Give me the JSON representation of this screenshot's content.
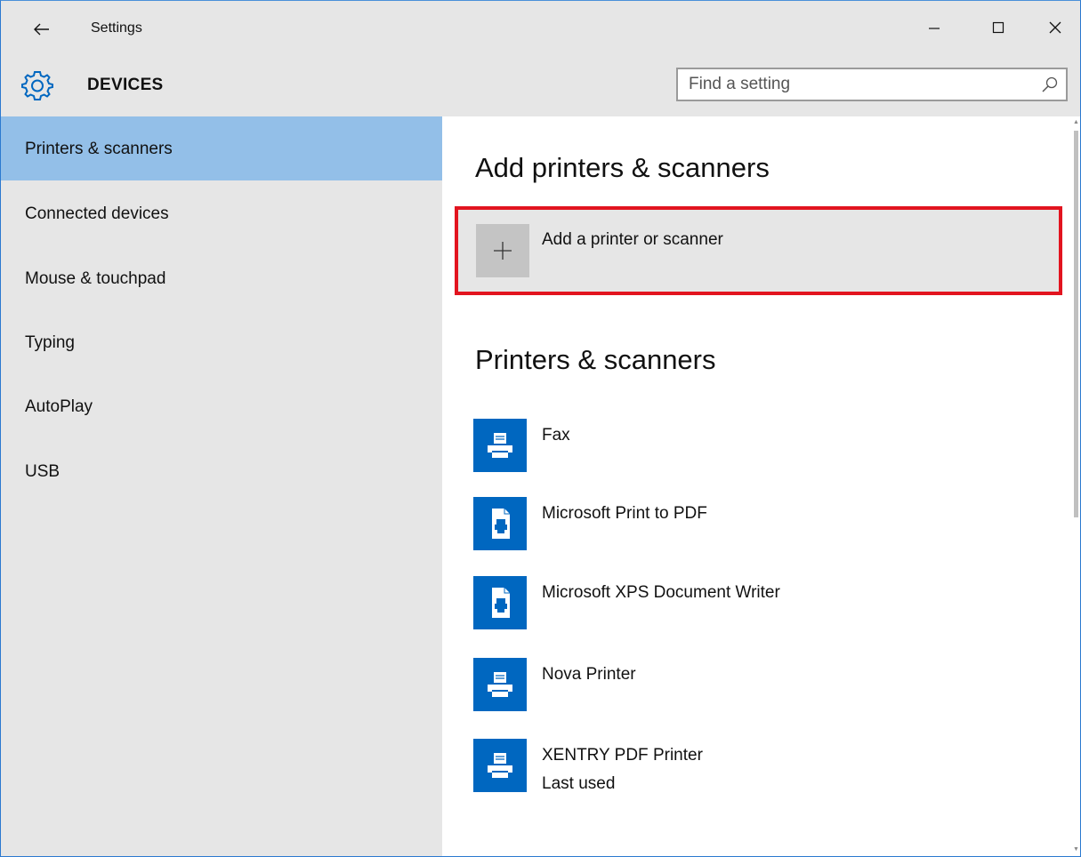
{
  "window": {
    "title": "Settings",
    "section": "DEVICES"
  },
  "search": {
    "placeholder": "Find a setting"
  },
  "sidebar": {
    "items": [
      {
        "label": "Printers & scanners",
        "active": true
      },
      {
        "label": "Connected devices"
      },
      {
        "label": "Mouse & touchpad"
      },
      {
        "label": "Typing"
      },
      {
        "label": "AutoPlay"
      },
      {
        "label": "USB"
      }
    ]
  },
  "main": {
    "add_heading": "Add printers & scanners",
    "add_button_label": "Add a printer or scanner",
    "list_heading": "Printers & scanners",
    "printers": [
      {
        "name": "Fax",
        "icon": "printer-icon"
      },
      {
        "name": "Microsoft Print to PDF",
        "icon": "document-printer-icon"
      },
      {
        "name": "Microsoft XPS Document Writer",
        "icon": "document-printer-icon"
      },
      {
        "name": "Nova Printer",
        "icon": "printer-icon"
      },
      {
        "name": "XENTRY PDF Printer",
        "status": "Last used",
        "icon": "printer-icon"
      }
    ]
  },
  "colors": {
    "accent": "#0067c0",
    "selection": "#93bfe8",
    "highlight_border": "#e2141f",
    "chrome": "#e6e6e6"
  }
}
